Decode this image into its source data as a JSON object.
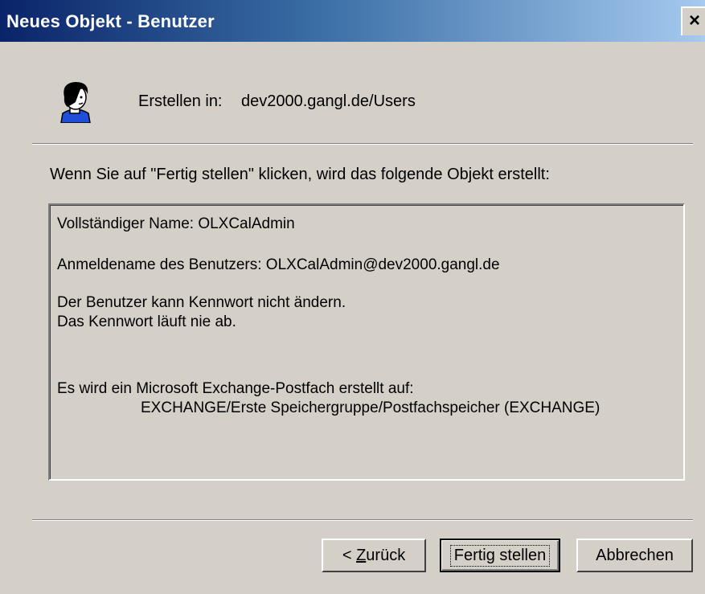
{
  "window": {
    "title": "Neues Objekt - Benutzer",
    "close_glyph": "×"
  },
  "header": {
    "icon": "user-icon",
    "create_in_label": "Erstellen in:",
    "create_in_value": "dev2000.gangl.de/Users"
  },
  "intro_text": "Wenn Sie auf \"Fertig stellen\" klicken, wird das folgende Objekt erstellt:",
  "summary": {
    "full_name": "Vollständiger Name: OLXCalAdmin",
    "logon_name": "Anmeldename des Benutzers: OLXCalAdmin@dev2000.gangl.de",
    "password_cannot_change": "Der Benutzer kann Kennwort nicht ändern.",
    "password_never_expires": "Das Kennwort läuft nie ab.",
    "mailbox_intro": "Es wird ein Microsoft Exchange-Postfach erstellt auf:",
    "mailbox_store": "EXCHANGE/Erste Speichergruppe/Postfachspeicher (EXCHANGE)"
  },
  "buttons": {
    "back_prefix": "< ",
    "back_mnemonic": "Z",
    "back_rest": "urück",
    "finish": "Fertig stellen",
    "cancel": "Abbrechen"
  }
}
